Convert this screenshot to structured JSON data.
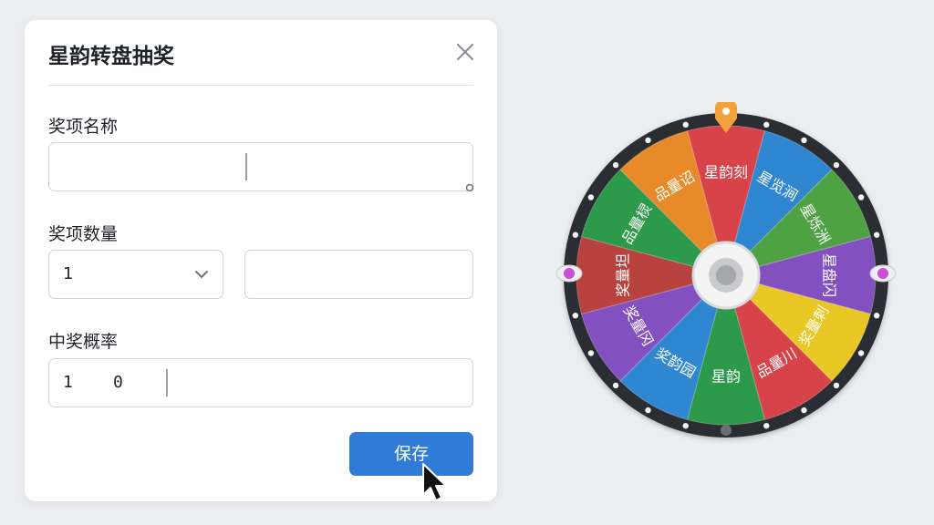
{
  "dialog": {
    "title": "星韵转盘抽奖",
    "prize_name_label": "奖项名称",
    "prize_name_value": "",
    "prize_qty_label": "奖项数量",
    "prize_qty_selected": "1",
    "prize_qty_extra_value": "",
    "prob_label": "中奖概率",
    "prob_int": "1",
    "prob_dec": "0",
    "save_label": "保存"
  },
  "wheel": {
    "segments": [
      {
        "label": "星韵刻",
        "color": "#d8434a"
      },
      {
        "label": "星览涧",
        "color": "#2f86d1"
      },
      {
        "label": "星烁洲",
        "color": "#4ea244"
      },
      {
        "label": "星盘闪",
        "color": "#8351bf"
      },
      {
        "label": "奖量刺",
        "color": "#e8c623"
      },
      {
        "label": "品量川",
        "color": "#d8434a"
      },
      {
        "label": "星韵",
        "color": "#2c9a4a"
      },
      {
        "label": "奖韵园",
        "color": "#2f86d1"
      },
      {
        "label": "奖量冈",
        "color": "#8351bf"
      },
      {
        "label": "奖量坦",
        "color": "#b8423d"
      },
      {
        "label": "品量棂",
        "color": "#2c9a4a"
      },
      {
        "label": "品量诏",
        "color": "#e98a2a"
      }
    ],
    "pointer_color": "#f2a23c",
    "side_knob_color": "#c94fd6"
  }
}
